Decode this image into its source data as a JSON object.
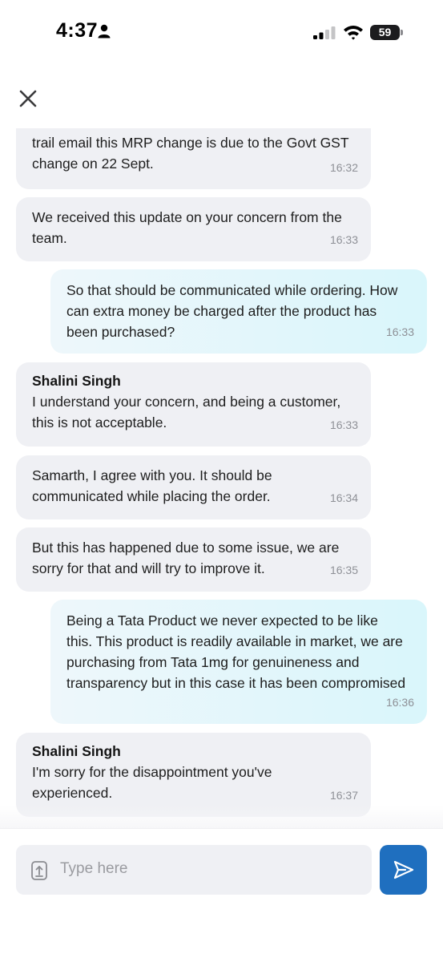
{
  "status_bar": {
    "time": "4:37",
    "battery": "59"
  },
  "composer": {
    "placeholder": "Type here"
  },
  "colors": {
    "incoming_bubble": "#eff0f4",
    "outgoing_bubble": "#d9f6fb",
    "send_button": "#1f6fbf",
    "timestamp": "#8e9096"
  },
  "icons": {
    "close": "close-icon",
    "attach": "attach-upload-icon",
    "send": "send-icon"
  },
  "messages": [
    {
      "direction": "incoming",
      "sender": "",
      "text_lines": [
        "trail email this MRP change is due to the Govt GST",
        "change on 22 Sept."
      ],
      "time": "16:32"
    },
    {
      "direction": "incoming",
      "sender": "",
      "text_lines": [
        "We received this update on your concern from the",
        "team."
      ],
      "time": "16:33"
    },
    {
      "direction": "outgoing",
      "sender": "",
      "text_lines": [
        "So that should be communicated while ordering. How",
        "can extra money be charged after the product has",
        "been purchased?"
      ],
      "time": "16:33"
    },
    {
      "direction": "incoming",
      "sender": "Shalini Singh",
      "text_lines": [
        "I understand your concern, and being a customer,",
        "this is not acceptable."
      ],
      "time": "16:33"
    },
    {
      "direction": "incoming",
      "sender": "",
      "text_lines": [
        "Samarth, I agree with you. It should be",
        "communicated while placing the order."
      ],
      "time": "16:34"
    },
    {
      "direction": "incoming",
      "sender": "",
      "text_lines": [
        "But this has happened due to some issue, we are",
        "sorry for that and will try to improve it."
      ],
      "time": "16:35"
    },
    {
      "direction": "outgoing",
      "sender": "",
      "text_lines": [
        "Being a Tata Product we never expected to be like",
        "this. This product is readily available in market, we are",
        "purchasing from Tata 1mg for genuineness and",
        "transparency but in this case it has been compromised"
      ],
      "time": "16:36"
    },
    {
      "direction": "incoming",
      "sender": "Shalini Singh",
      "text_lines": [
        "I'm sorry for the disappointment you've",
        "experienced."
      ],
      "time": "16:37"
    }
  ]
}
